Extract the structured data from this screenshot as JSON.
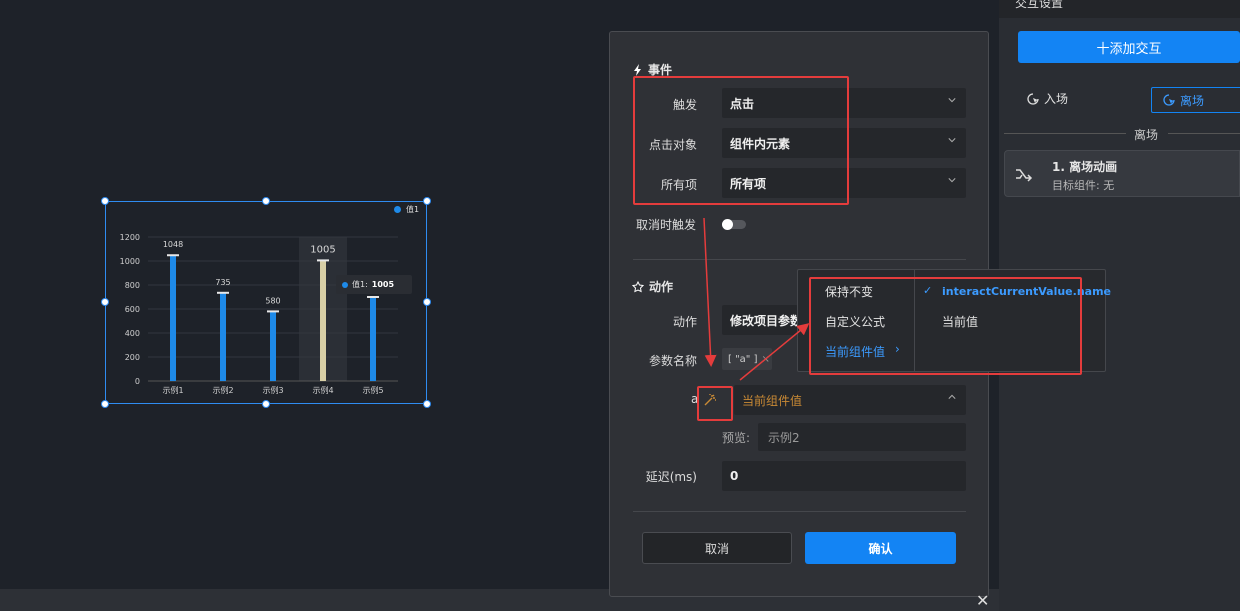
{
  "chart": {
    "legend_label": "值1",
    "tooltip": {
      "series": "值1:",
      "value": "1005"
    }
  },
  "chart_data": {
    "type": "bar",
    "categories": [
      "示例1",
      "示例2",
      "示例3",
      "示例4",
      "示例5"
    ],
    "series": [
      {
        "name": "值1",
        "values": [
          1048,
          735,
          580,
          1005,
          700
        ]
      }
    ],
    "data_labels": [
      "1048",
      "735",
      "580",
      "1005",
      ""
    ],
    "ylim": [
      0,
      1200
    ],
    "yticks": [
      "0",
      "200",
      "400",
      "600",
      "800",
      "1000",
      "1200"
    ],
    "highlighted_category": "示例4",
    "colors": {
      "bar": "#1e8ae8",
      "highlight": "#d8cfa6"
    },
    "grid": true,
    "legend_position": "top-right"
  },
  "right_panel": {
    "title": "交互设置",
    "add_button": "十添加交互",
    "tab_enter": "入场",
    "tab_exit": "离场",
    "section_title": "离场",
    "anim_item": {
      "title": "1. 离场动画",
      "subtitle": "目标组件: 无"
    }
  },
  "dialog": {
    "event_section": "事件",
    "trigger_label": "触发",
    "trigger_value": "点击",
    "click_target_label": "点击对象",
    "click_target_value": "组件内元素",
    "all_items_label": "所有项",
    "all_items_value": "所有项",
    "cancel_trigger_label": "取消时触发",
    "action_section": "动作",
    "action_label": "动作",
    "action_value": "修改项目参数",
    "param_name_label": "参数名称",
    "param_tag": "[ \"a\" ]",
    "param_row_label": "a",
    "param_value": "当前组件值",
    "preview_label": "预览:",
    "preview_value": "示例2",
    "delay_label": "延迟(ms)",
    "delay_value": "0",
    "cancel_button": "取消",
    "confirm_button": "确认"
  },
  "popup_menu": {
    "left_items": [
      "保持不变",
      "自定义公式",
      "当前组件值"
    ],
    "right_items": [
      "interactCurrentValue.name",
      "当前值"
    ]
  },
  "colors": {
    "accent": "#1384f4",
    "highlight_red": "#e43c3c",
    "formula_orange": "#c98a35"
  }
}
